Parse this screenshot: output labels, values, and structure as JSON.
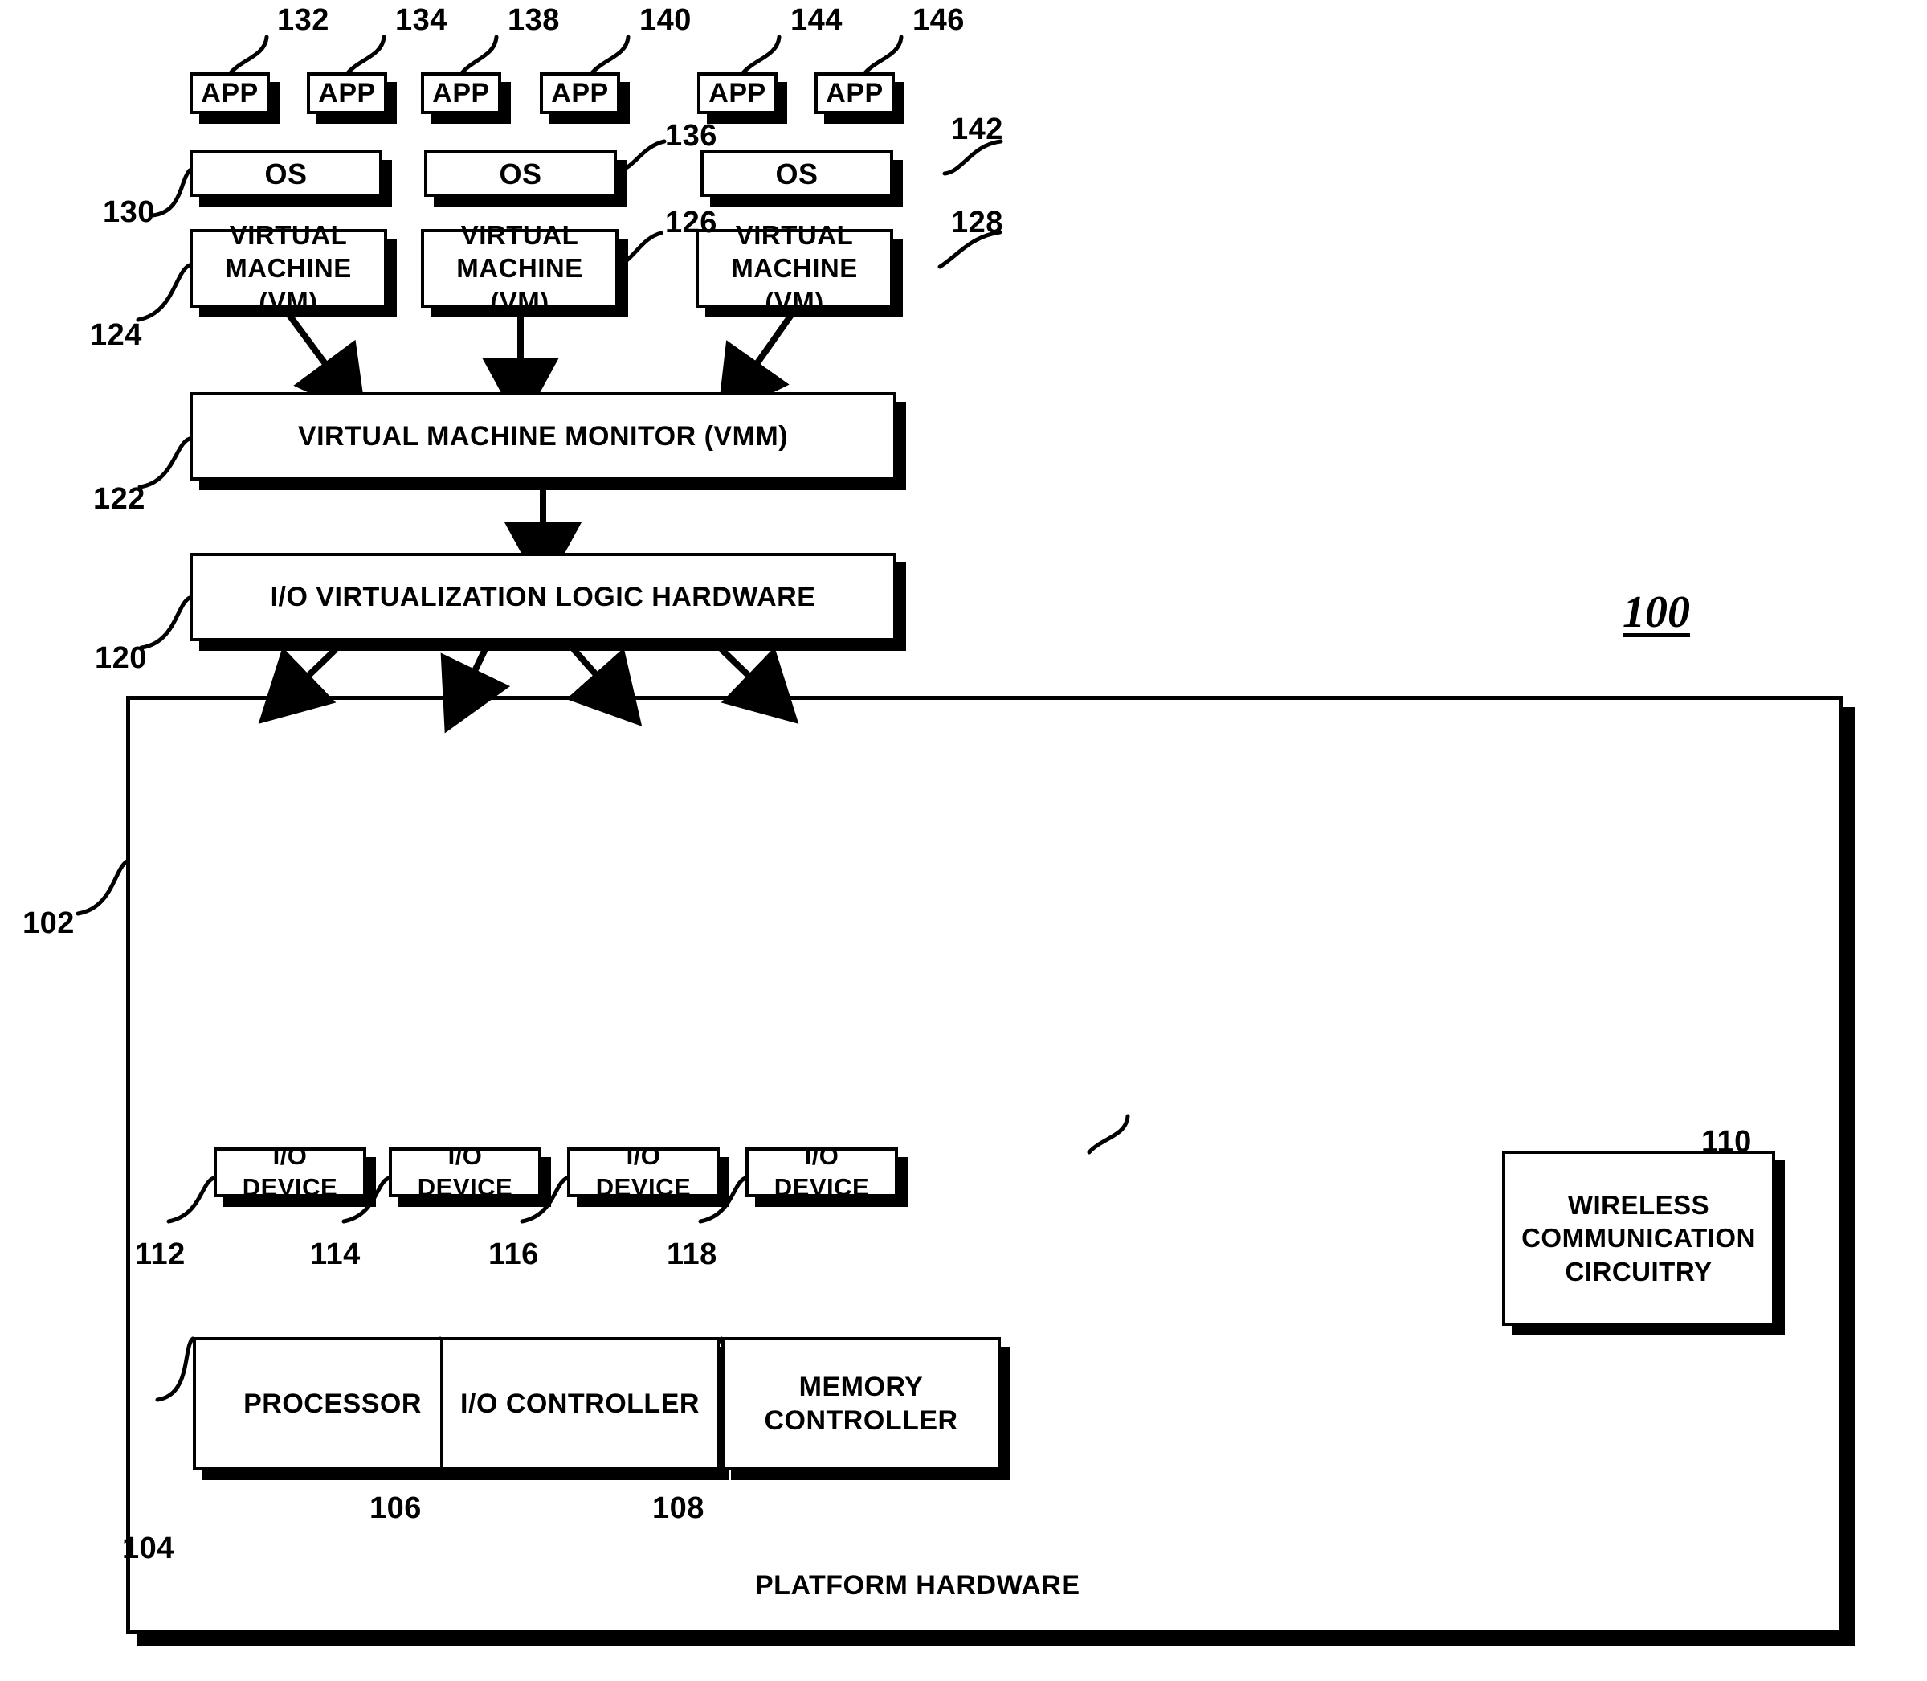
{
  "figure": {
    "number": "100",
    "platform_label": "PLATFORM HARDWARE"
  },
  "apps": [
    {
      "label": "APP",
      "ref": "132"
    },
    {
      "label": "APP",
      "ref": "134"
    },
    {
      "label": "APP",
      "ref": "138"
    },
    {
      "label": "APP",
      "ref": "140"
    },
    {
      "label": "APP",
      "ref": "144"
    },
    {
      "label": "APP",
      "ref": "146"
    }
  ],
  "operating_systems": [
    {
      "label": "OS",
      "ref": "130"
    },
    {
      "label": "OS",
      "ref": "136"
    },
    {
      "label": "OS",
      "ref": "142"
    }
  ],
  "virtual_machines": [
    {
      "line1": "VIRTUAL MACHINE",
      "line2": "(VM)",
      "ref": "124"
    },
    {
      "line1": "VIRTUAL MACHINE",
      "line2": "(VM)",
      "ref": "126"
    },
    {
      "line1": "VIRTUAL MACHINE",
      "line2": "(VM)",
      "ref": "128"
    }
  ],
  "vmm": {
    "label": "VIRTUAL MACHINE MONITOR (VMM)",
    "ref": "122"
  },
  "io_virtualization": {
    "label": "I/O VIRTUALIZATION LOGIC HARDWARE",
    "ref": "120"
  },
  "platform": {
    "ref": "102",
    "io_devices": [
      {
        "label": "I/O DEVICE",
        "ref": "112"
      },
      {
        "label": "I/O DEVICE",
        "ref": "114"
      },
      {
        "label": "I/O DEVICE",
        "ref": "116"
      },
      {
        "label": "I/O DEVICE",
        "ref": "118"
      }
    ],
    "components": [
      {
        "line1": "PROCESSOR",
        "line2": "",
        "ref": "104"
      },
      {
        "line1": "I/O CONTROLLER",
        "line2": "",
        "ref": "106"
      },
      {
        "line1": "MEMORY",
        "line2": "CONTROLLER",
        "ref": "108"
      }
    ],
    "wireless": {
      "line1": "WIRELESS",
      "line2": "COMMUNICATION",
      "line3": "CIRCUITRY",
      "ref": "110"
    }
  }
}
